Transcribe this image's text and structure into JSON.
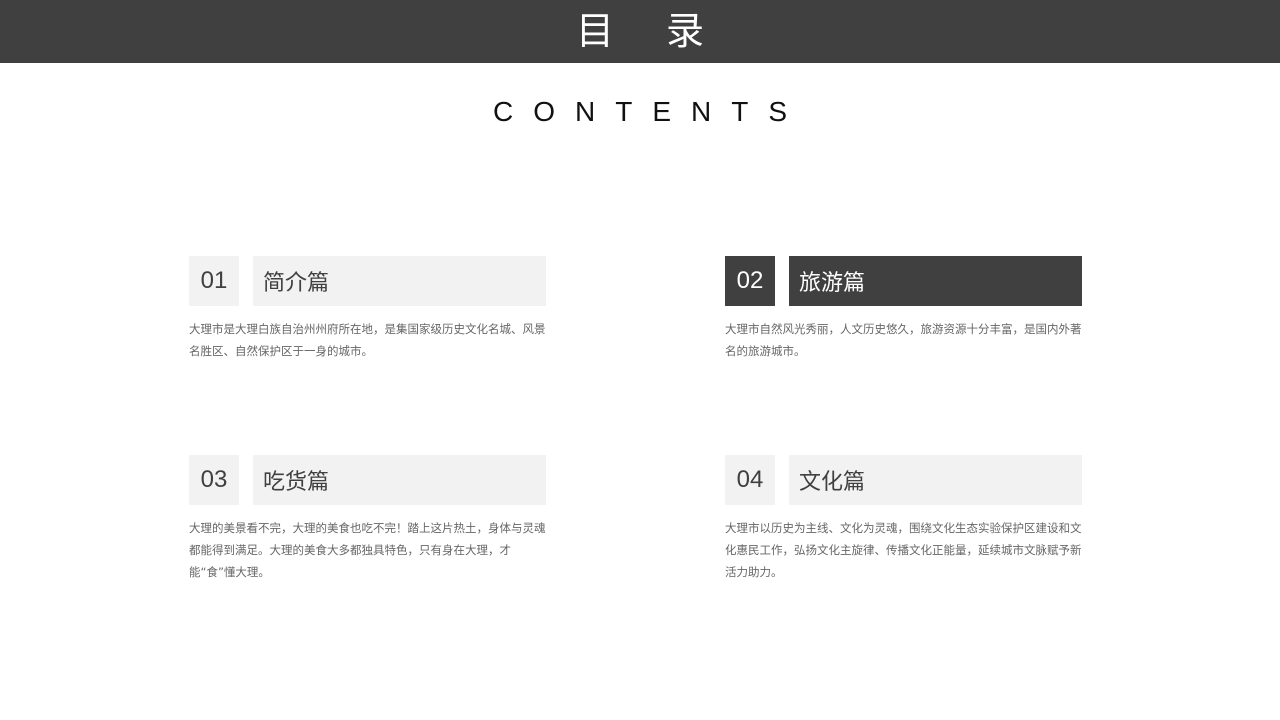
{
  "header": {
    "title": "目 录",
    "subtitle": "CONTENTS"
  },
  "sections": [
    {
      "number": "01",
      "title": "简介篇",
      "description": "大理市是大理白族自治州州府所在地，是集国家级历史文化名城、风景名胜区、自然保护区于一身的城市。"
    },
    {
      "number": "02",
      "title": "旅游篇",
      "description": "大理市自然风光秀丽，人文历史悠久，旅游资源十分丰富，是国内外著名的旅游城市。"
    },
    {
      "number": "03",
      "title": "吃货篇",
      "description": "大理的美景看不完，大理的美食也吃不完！踏上这片热土，身体与灵魂都能得到满足。大理的美食大多都独具特色，只有身在大理，才能“食”懂大理。"
    },
    {
      "number": "04",
      "title": "文化篇",
      "description": "大理市以历史为主线、文化为灵魂，围绕文化生态实验保护区建设和文化惠民工作，弘扬文化主旋律、传播文化正能量，延续城市文脉赋予新活力助力。"
    }
  ],
  "colors": {
    "dark": "#404040",
    "light": "#f2f2f2",
    "text": "#666666"
  }
}
